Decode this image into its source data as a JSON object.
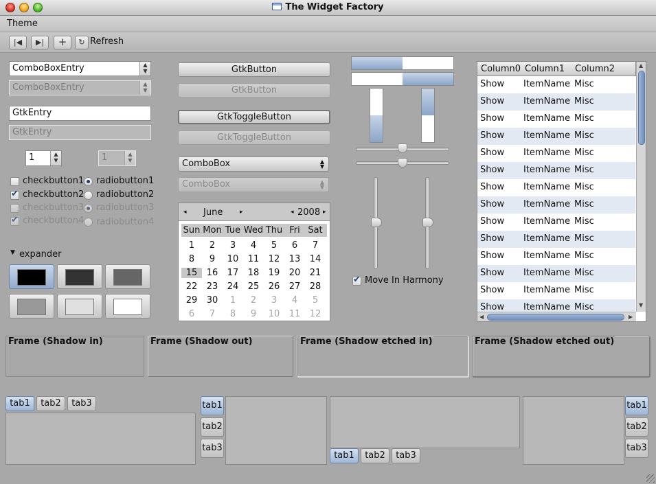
{
  "window": {
    "title": "The Widget Factory"
  },
  "menubar": {
    "theme": "Theme"
  },
  "toolbar": {
    "refresh": "Refresh",
    "icons": [
      "go-first-icon",
      "go-last-icon",
      "add-icon",
      "refresh-icon"
    ]
  },
  "left": {
    "combo_entry": "ComboBoxEntry",
    "combo_entry_dis": "ComboBoxEntry",
    "entry": "GtkEntry",
    "entry_dis": "GtkEntry",
    "spin": "1",
    "spin_dis": "1",
    "check1": "checkbutton1",
    "check2": "checkbutton2",
    "check3": "checkbutton3",
    "check4": "checkbutton4",
    "radio1": "radiobutton1",
    "radio2": "radiobutton2",
    "radio3": "radiobutton3",
    "radio4": "radiobutton4",
    "expander": "expander",
    "swatches": [
      "#000000",
      "#333333",
      "#666666",
      "#999999",
      "#e0e0e0",
      "#ffffff"
    ]
  },
  "center": {
    "button": "GtkButton",
    "button_dis": "GtkButton",
    "toggle": "GtkToggleButton",
    "toggle_dis": "GtkToggleButton",
    "combo": "ComboBox",
    "combo_dis": "ComboBox",
    "calendar": {
      "month": "June",
      "year": "2008",
      "days": [
        "Sun",
        "Mon",
        "Tue",
        "Wed",
        "Thu",
        "Fri",
        "Sat"
      ],
      "weeks": [
        [
          "1",
          "2",
          "3",
          "4",
          "5",
          "6",
          "7"
        ],
        [
          "8",
          "9",
          "10",
          "11",
          "12",
          "13",
          "14"
        ],
        [
          "15",
          "16",
          "17",
          "18",
          "19",
          "20",
          "21"
        ],
        [
          "22",
          "23",
          "24",
          "25",
          "26",
          "27",
          "28"
        ],
        [
          "29",
          "30",
          "1",
          "2",
          "3",
          "4",
          "5"
        ],
        [
          "6",
          "7",
          "8",
          "9",
          "10",
          "11",
          "12"
        ]
      ]
    }
  },
  "sliders": {
    "move_in_harmony": "Move In Harmony",
    "progress_h1": 0.5,
    "progress_h2": 0.5,
    "progress_v1": 0.5,
    "progress_v2": 0.5
  },
  "tree": {
    "columns": [
      "Column0",
      "Column1",
      "Column2"
    ],
    "rows": [
      [
        "Show",
        "ItemName",
        "Misc"
      ],
      [
        "Show",
        "ItemName",
        "Misc"
      ],
      [
        "Show",
        "ItemName",
        "Misc"
      ],
      [
        "Show",
        "ItemName",
        "Misc"
      ],
      [
        "Show",
        "ItemName",
        "Misc"
      ],
      [
        "Show",
        "ItemName",
        "Misc"
      ],
      [
        "Show",
        "ItemName",
        "Misc"
      ],
      [
        "Show",
        "ItemName",
        "Misc"
      ],
      [
        "Show",
        "ItemName",
        "Misc"
      ],
      [
        "Show",
        "ItemName",
        "Misc"
      ],
      [
        "Show",
        "ItemName",
        "Misc"
      ],
      [
        "Show",
        "ItemName",
        "Misc"
      ],
      [
        "Show",
        "ItemName",
        "Misc"
      ],
      [
        "Show",
        "ItemName",
        "Misc"
      ]
    ]
  },
  "frames": {
    "in": "Frame (Shadow in)",
    "out": "Frame (Shadow out)",
    "etched_in": "Frame (Shadow etched in)",
    "etched_out": "Frame (Shadow etched out)"
  },
  "tabs": {
    "t1": "tab1",
    "t2": "tab2",
    "t3": "tab3"
  },
  "colors": {
    "accent": "#9fb6d6",
    "background": "#a8a8a8",
    "row_alt": "#e3e9f3"
  }
}
